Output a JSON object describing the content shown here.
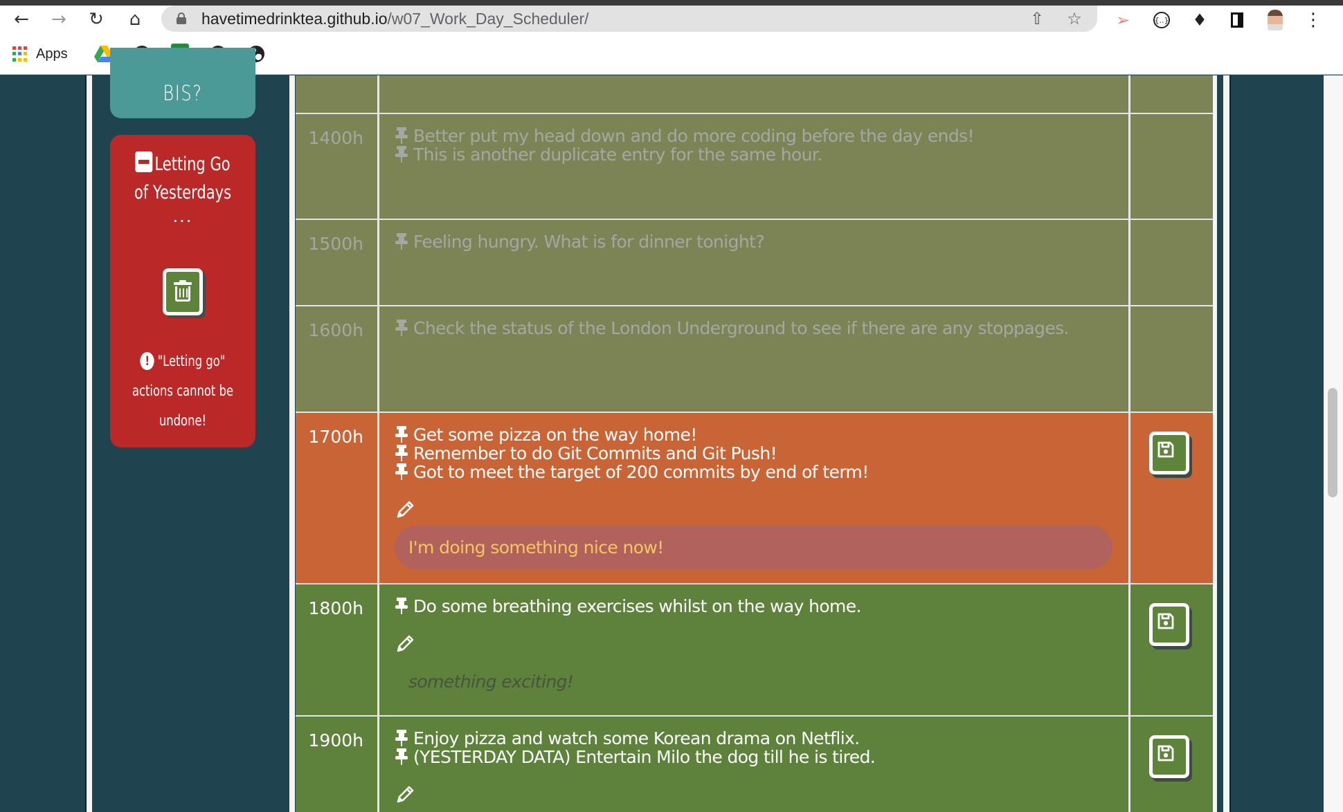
{
  "browser": {
    "url_host": "havetimedrinktea.github.io",
    "url_path": "/w07_Work_Day_Scheduler/",
    "nav": {
      "back_icon": "arrow-left-icon",
      "forward_icon": "arrow-right-icon",
      "reload_icon": "reload-icon",
      "home_icon": "home-icon"
    },
    "bookmarks": {
      "apps_label": "Apps",
      "items": [
        "google-drive",
        "globe",
        "google-sheets",
        "globe",
        "globe"
      ]
    }
  },
  "sidebar": {
    "top_card_text": "BIS?",
    "letting_go": {
      "title_line1": "Letting Go",
      "title_line2": "of Yesterdays",
      "ellipsis": "...",
      "trash_button_icon": "trash-icon",
      "warning_line1": "\"Letting go\"",
      "warning_line2": "actions cannot be",
      "warning_line3": "undone!"
    }
  },
  "schedule": {
    "rows": [
      {
        "hour": "",
        "state": "past",
        "tasks": []
      },
      {
        "hour": "1400h",
        "state": "past",
        "tasks": [
          "Better put my head down and do more coding before the day ends!",
          "This is another duplicate entry for the same hour."
        ]
      },
      {
        "hour": "1500h",
        "state": "past",
        "tasks": [
          "Feeling hungry. What is for dinner tonight?"
        ]
      },
      {
        "hour": "1600h",
        "state": "past",
        "tasks": [
          "Check the status of the London Underground to see if there are any stoppages."
        ]
      },
      {
        "hour": "1700h",
        "state": "present",
        "tasks": [
          "Get some pizza on the way home!",
          "Remember to do Git Commits and Git Push!",
          "Got to meet the target of 200 commits by end of term!"
        ],
        "input_value": "I'm doing something nice now!",
        "input_placeholder": ""
      },
      {
        "hour": "1800h",
        "state": "future",
        "tasks": [
          "Do some breathing exercises whilst on the way home."
        ],
        "input_value": "",
        "input_placeholder": "something exciting!"
      },
      {
        "hour": "1900h",
        "state": "future",
        "tasks": [
          "Enjoy pizza and watch some Korean drama on Netflix.",
          "(YESTERDAY DATA) Entertain Milo the dog till he is tired."
        ]
      }
    ]
  },
  "colors": {
    "past": "#7c8456",
    "present": "#c86435",
    "future": "#5e823c",
    "danger": "#bb2828",
    "teal": "#4c9a97",
    "background": "#1f4450"
  }
}
